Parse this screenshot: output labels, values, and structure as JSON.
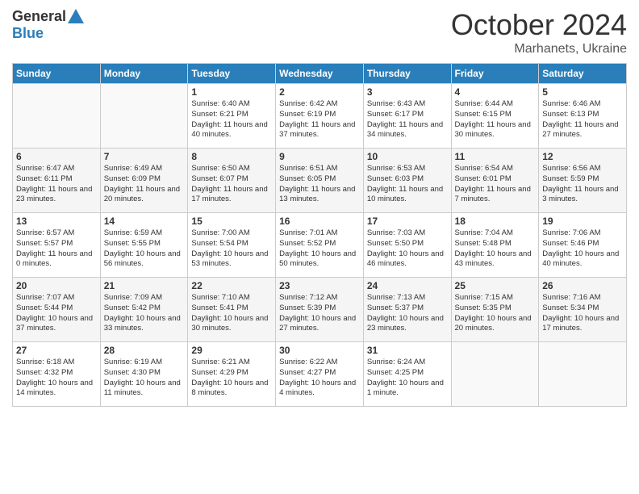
{
  "header": {
    "logo_general": "General",
    "logo_blue": "Blue",
    "month": "October 2024",
    "location": "Marhanets, Ukraine"
  },
  "days_of_week": [
    "Sunday",
    "Monday",
    "Tuesday",
    "Wednesday",
    "Thursday",
    "Friday",
    "Saturday"
  ],
  "weeks": [
    [
      {
        "day": "",
        "info": ""
      },
      {
        "day": "",
        "info": ""
      },
      {
        "day": "1",
        "info": "Sunrise: 6:40 AM\nSunset: 6:21 PM\nDaylight: 11 hours and 40 minutes."
      },
      {
        "day": "2",
        "info": "Sunrise: 6:42 AM\nSunset: 6:19 PM\nDaylight: 11 hours and 37 minutes."
      },
      {
        "day": "3",
        "info": "Sunrise: 6:43 AM\nSunset: 6:17 PM\nDaylight: 11 hours and 34 minutes."
      },
      {
        "day": "4",
        "info": "Sunrise: 6:44 AM\nSunset: 6:15 PM\nDaylight: 11 hours and 30 minutes."
      },
      {
        "day": "5",
        "info": "Sunrise: 6:46 AM\nSunset: 6:13 PM\nDaylight: 11 hours and 27 minutes."
      }
    ],
    [
      {
        "day": "6",
        "info": "Sunrise: 6:47 AM\nSunset: 6:11 PM\nDaylight: 11 hours and 23 minutes."
      },
      {
        "day": "7",
        "info": "Sunrise: 6:49 AM\nSunset: 6:09 PM\nDaylight: 11 hours and 20 minutes."
      },
      {
        "day": "8",
        "info": "Sunrise: 6:50 AM\nSunset: 6:07 PM\nDaylight: 11 hours and 17 minutes."
      },
      {
        "day": "9",
        "info": "Sunrise: 6:51 AM\nSunset: 6:05 PM\nDaylight: 11 hours and 13 minutes."
      },
      {
        "day": "10",
        "info": "Sunrise: 6:53 AM\nSunset: 6:03 PM\nDaylight: 11 hours and 10 minutes."
      },
      {
        "day": "11",
        "info": "Sunrise: 6:54 AM\nSunset: 6:01 PM\nDaylight: 11 hours and 7 minutes."
      },
      {
        "day": "12",
        "info": "Sunrise: 6:56 AM\nSunset: 5:59 PM\nDaylight: 11 hours and 3 minutes."
      }
    ],
    [
      {
        "day": "13",
        "info": "Sunrise: 6:57 AM\nSunset: 5:57 PM\nDaylight: 11 hours and 0 minutes."
      },
      {
        "day": "14",
        "info": "Sunrise: 6:59 AM\nSunset: 5:55 PM\nDaylight: 10 hours and 56 minutes."
      },
      {
        "day": "15",
        "info": "Sunrise: 7:00 AM\nSunset: 5:54 PM\nDaylight: 10 hours and 53 minutes."
      },
      {
        "day": "16",
        "info": "Sunrise: 7:01 AM\nSunset: 5:52 PM\nDaylight: 10 hours and 50 minutes."
      },
      {
        "day": "17",
        "info": "Sunrise: 7:03 AM\nSunset: 5:50 PM\nDaylight: 10 hours and 46 minutes."
      },
      {
        "day": "18",
        "info": "Sunrise: 7:04 AM\nSunset: 5:48 PM\nDaylight: 10 hours and 43 minutes."
      },
      {
        "day": "19",
        "info": "Sunrise: 7:06 AM\nSunset: 5:46 PM\nDaylight: 10 hours and 40 minutes."
      }
    ],
    [
      {
        "day": "20",
        "info": "Sunrise: 7:07 AM\nSunset: 5:44 PM\nDaylight: 10 hours and 37 minutes."
      },
      {
        "day": "21",
        "info": "Sunrise: 7:09 AM\nSunset: 5:42 PM\nDaylight: 10 hours and 33 minutes."
      },
      {
        "day": "22",
        "info": "Sunrise: 7:10 AM\nSunset: 5:41 PM\nDaylight: 10 hours and 30 minutes."
      },
      {
        "day": "23",
        "info": "Sunrise: 7:12 AM\nSunset: 5:39 PM\nDaylight: 10 hours and 27 minutes."
      },
      {
        "day": "24",
        "info": "Sunrise: 7:13 AM\nSunset: 5:37 PM\nDaylight: 10 hours and 23 minutes."
      },
      {
        "day": "25",
        "info": "Sunrise: 7:15 AM\nSunset: 5:35 PM\nDaylight: 10 hours and 20 minutes."
      },
      {
        "day": "26",
        "info": "Sunrise: 7:16 AM\nSunset: 5:34 PM\nDaylight: 10 hours and 17 minutes."
      }
    ],
    [
      {
        "day": "27",
        "info": "Sunrise: 6:18 AM\nSunset: 4:32 PM\nDaylight: 10 hours and 14 minutes."
      },
      {
        "day": "28",
        "info": "Sunrise: 6:19 AM\nSunset: 4:30 PM\nDaylight: 10 hours and 11 minutes."
      },
      {
        "day": "29",
        "info": "Sunrise: 6:21 AM\nSunset: 4:29 PM\nDaylight: 10 hours and 8 minutes."
      },
      {
        "day": "30",
        "info": "Sunrise: 6:22 AM\nSunset: 4:27 PM\nDaylight: 10 hours and 4 minutes."
      },
      {
        "day": "31",
        "info": "Sunrise: 6:24 AM\nSunset: 4:25 PM\nDaylight: 10 hours and 1 minute."
      },
      {
        "day": "",
        "info": ""
      },
      {
        "day": "",
        "info": ""
      }
    ]
  ]
}
